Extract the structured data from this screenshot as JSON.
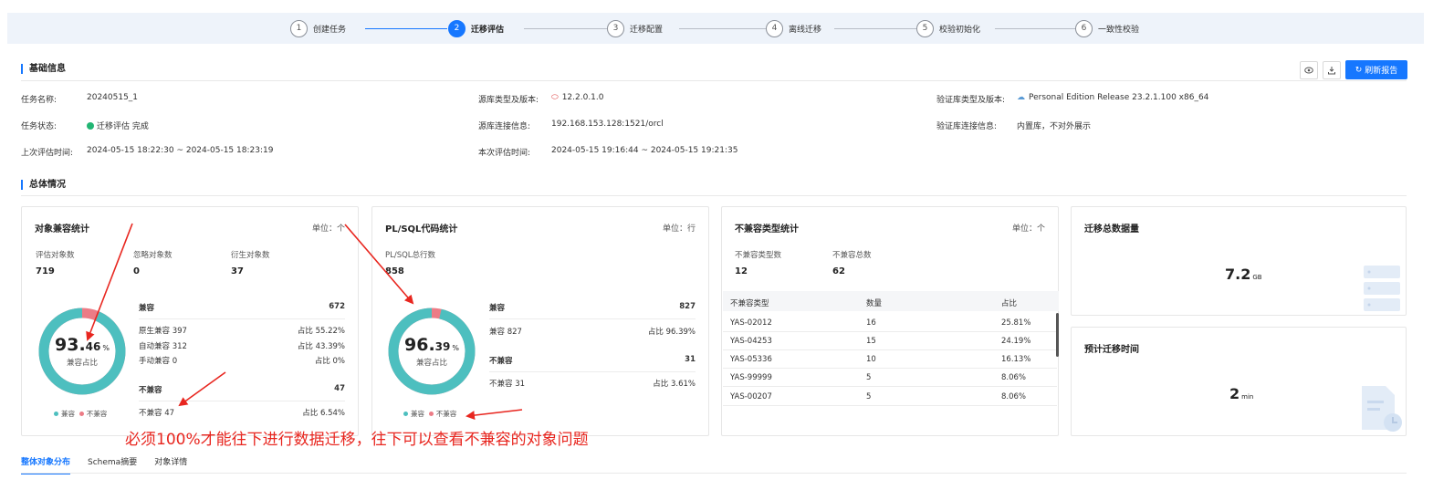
{
  "steps": [
    {
      "num": "1",
      "label": "创建任务"
    },
    {
      "num": "2",
      "label": "迁移评估"
    },
    {
      "num": "3",
      "label": "迁移配置"
    },
    {
      "num": "4",
      "label": "离线迁移"
    },
    {
      "num": "5",
      "label": "校验初始化"
    },
    {
      "num": "6",
      "label": "一致性校验"
    }
  ],
  "active_step": 2,
  "basic": {
    "title": "基础信息",
    "refresh_label": "刷新报告",
    "task_name_key": "任务名称:",
    "task_name": "20240515_1",
    "task_status_key": "任务状态:",
    "task_status": "迁移评估 完成",
    "last_eval_key": "上次评估时间:",
    "last_eval": "2024-05-15 18:22:30 ~ 2024-05-15 18:23:19",
    "src_type_key": "源库类型及版本:",
    "src_type": "12.2.0.1.0",
    "src_conn_key": "源库连接信息:",
    "src_conn": "192.168.153.128:1521/orcl",
    "this_eval_key": "本次评估时间:",
    "this_eval": "2024-05-15 19:16:44 ~ 2024-05-15 19:21:35",
    "ver_type_key": "验证库类型及版本:",
    "ver_type": "Personal Edition Release 23.2.1.100 x86_64",
    "ver_conn_key": "验证库连接信息:",
    "ver_conn": "内置库，不对外展示"
  },
  "overview_title": "总体情况",
  "object_card": {
    "title": "对象兼容统计",
    "unit": "单位：个",
    "stats": [
      {
        "label": "评估对象数",
        "value": "719"
      },
      {
        "label": "忽略对象数",
        "value": "0"
      },
      {
        "label": "衍生对象数",
        "value": "37"
      }
    ],
    "donut_int": "93.",
    "donut_dec": "46",
    "donut_pct": "%",
    "donut_sub": "兼容占比",
    "compatible_fraction": 0.9346,
    "compat_label": "兼容",
    "compat_total": "672",
    "rows": [
      {
        "name": "原生兼容 397",
        "ratio": "占比 55.22%"
      },
      {
        "name": "自动兼容 312",
        "ratio": "占比 43.39%"
      },
      {
        "name": "手动兼容 0",
        "ratio": "占比 0%"
      }
    ],
    "incompat_label": "不兼容",
    "incompat_total": "47",
    "incompat_row": {
      "name": "不兼容 47",
      "ratio": "占比 6.54%"
    },
    "legend_ok": "兼容",
    "legend_bad": "不兼容"
  },
  "plsql_card": {
    "title": "PL/SQL代码统计",
    "unit": "单位：行",
    "stat_label": "PL/SQL总行数",
    "stat_value": "858",
    "donut_int": "96.",
    "donut_dec": "39",
    "donut_pct": "%",
    "donut_sub": "兼容占比",
    "compatible_fraction": 0.9639,
    "compat_label": "兼容",
    "compat_total": "827",
    "compat_row": {
      "name": "兼容 827",
      "ratio": "占比 96.39%"
    },
    "incompat_label": "不兼容",
    "incompat_total": "31",
    "incompat_row": {
      "name": "不兼容 31",
      "ratio": "占比 3.61%"
    },
    "legend_ok": "兼容",
    "legend_bad": "不兼容"
  },
  "incompat_card": {
    "title": "不兼容类型统计",
    "unit": "单位：个",
    "stats": [
      {
        "label": "不兼容类型数",
        "value": "12"
      },
      {
        "label": "不兼容总数",
        "value": "62"
      }
    ],
    "columns": [
      "不兼容类型",
      "数量",
      "占比"
    ],
    "rows": [
      [
        "YAS-02012",
        "16",
        "25.81%"
      ],
      [
        "YAS-04253",
        "15",
        "24.19%"
      ],
      [
        "YAS-05336",
        "10",
        "16.13%"
      ],
      [
        "YAS-99999",
        "5",
        "8.06%"
      ],
      [
        "YAS-00207",
        "5",
        "8.06%"
      ]
    ]
  },
  "volume_card": {
    "title": "迁移总数据量",
    "value": "7.2",
    "unit": "GB"
  },
  "time_card": {
    "title": "预计迁移时间",
    "value": "2",
    "unit": "min"
  },
  "annotation": "必须100%才能往下进行数据迁移，往下可以查看不兼容的对象问题",
  "tabs": [
    "整体对象分布",
    "Schema摘要",
    "对象详情"
  ],
  "colors": {
    "accent": "#1677ff",
    "compatible": "#4dbfbf",
    "incompatible": "#ec7c86",
    "annotation": "#e8261f",
    "ok": "#22b573"
  }
}
